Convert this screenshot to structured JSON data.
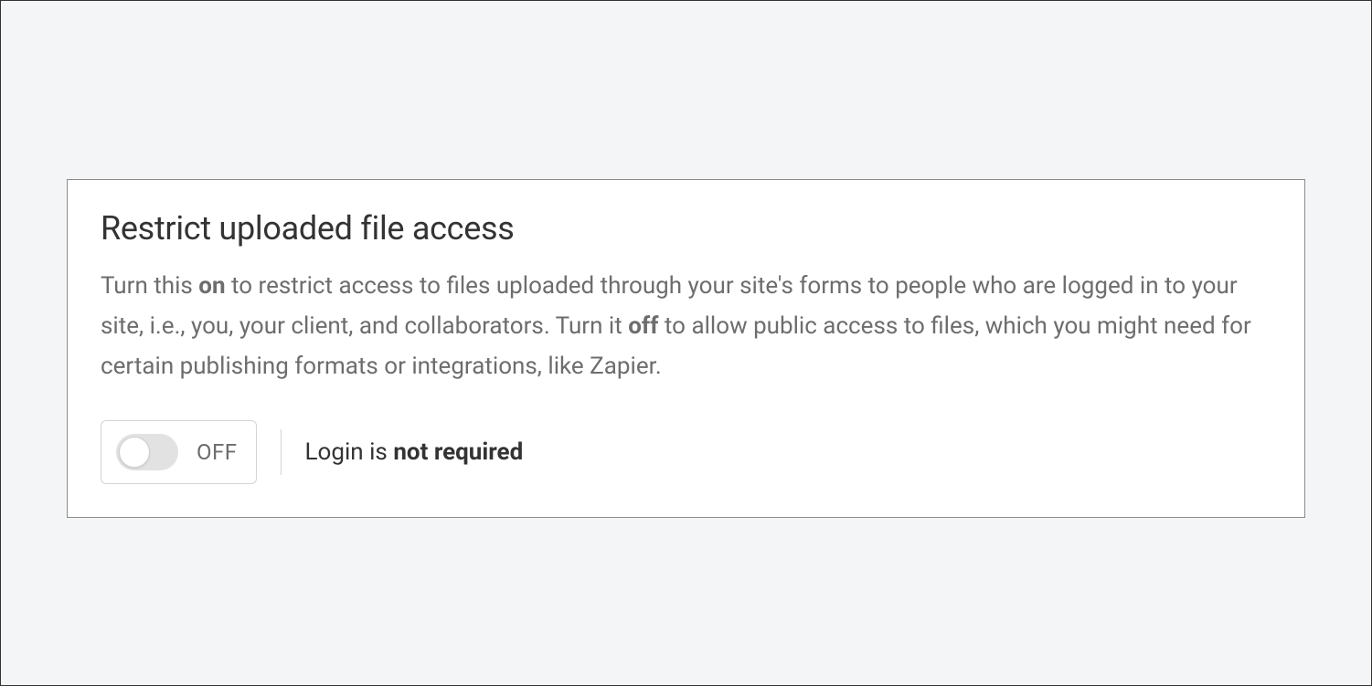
{
  "card": {
    "title": "Restrict uploaded file access",
    "description_1": "Turn this ",
    "description_bold_1": "on",
    "description_2": " to restrict access to files uploaded through your site's forms to people who are logged in to your site, i.e., you, your client, and collaborators. Turn it ",
    "description_bold_2": "off",
    "description_3": " to allow public access to files, which you might need for certain publishing formats or integrations, like Zapier."
  },
  "toggle": {
    "state_label": "OFF",
    "state": "off"
  },
  "status": {
    "prefix": "Login is ",
    "emphasis": "not required"
  }
}
